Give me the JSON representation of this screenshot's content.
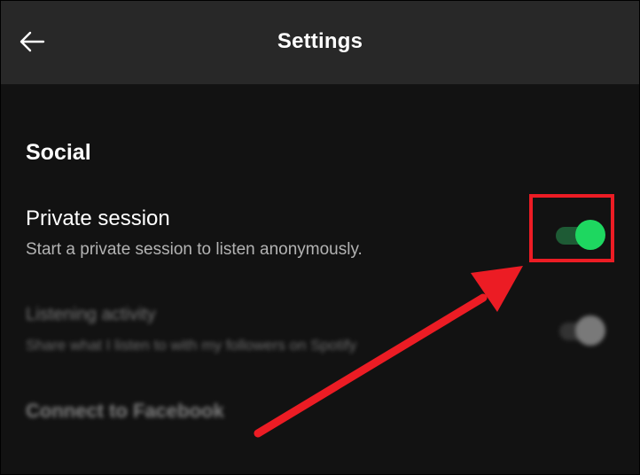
{
  "header": {
    "title": "Settings",
    "back_icon": "arrow-left-icon"
  },
  "section": {
    "title": "Social"
  },
  "settings": {
    "private_session": {
      "title": "Private session",
      "description": "Start a private session to listen anonymously.",
      "enabled": true
    },
    "listening_activity": {
      "title": "Listening activity",
      "description": "Share what I listen to with my followers on Spotify",
      "enabled": false
    },
    "facebook": {
      "title": "Connect to Facebook"
    }
  },
  "annotation": {
    "highlight_color": "#ec1c24",
    "arrow_color": "#ec1c24"
  },
  "colors": {
    "accent": "#1ed760",
    "background": "#121212",
    "header": "#282828"
  }
}
